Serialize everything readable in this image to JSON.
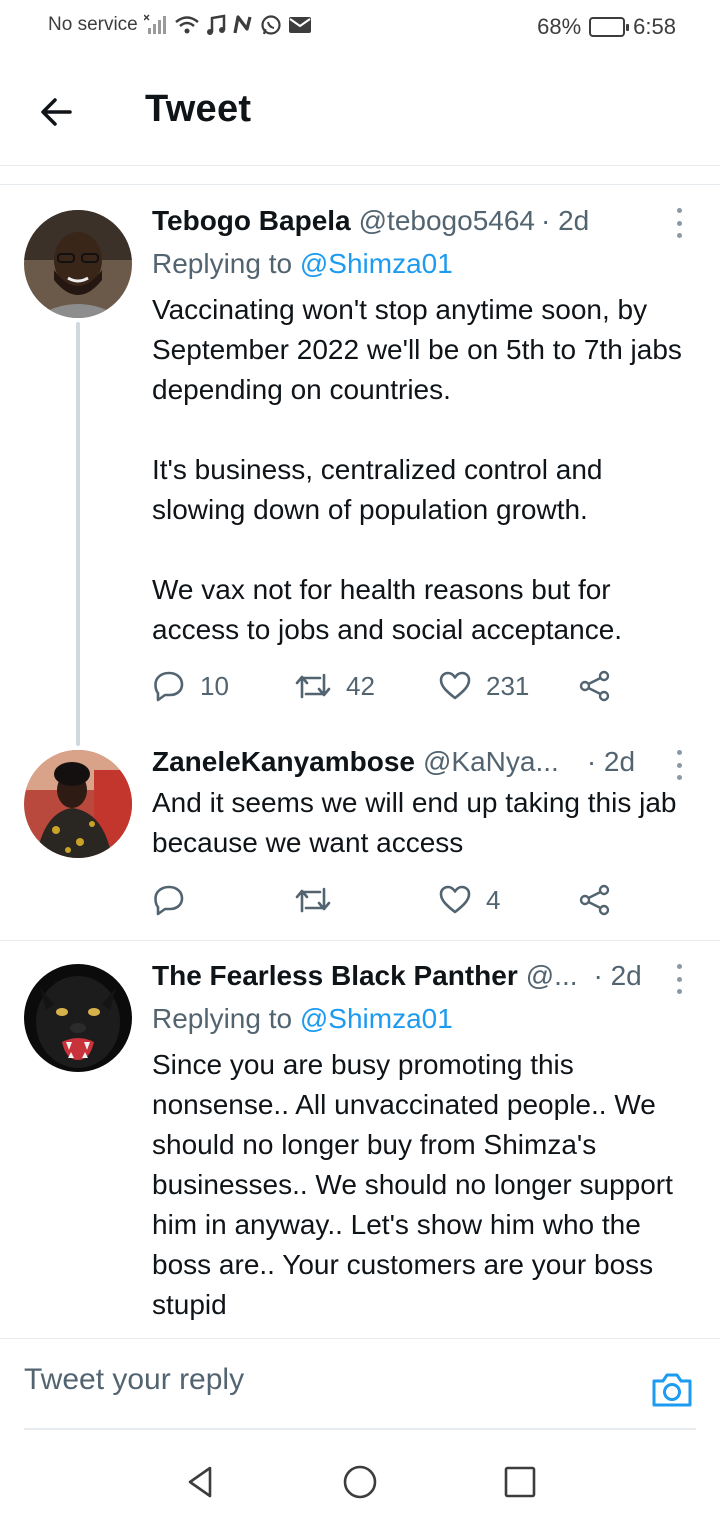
{
  "status_bar": {
    "carrier": "No service",
    "battery_percent": "68%",
    "battery_level": 0.68,
    "time": "6:58",
    "icons": [
      "signal-off-icon",
      "wifi-icon",
      "music-icon",
      "n-app-icon",
      "whatsapp-icon",
      "mail-icon"
    ]
  },
  "header": {
    "title": "Tweet"
  },
  "tweets": [
    {
      "name": "Tebogo Bapela",
      "handle": "@tebogo5464",
      "time": "· 2d",
      "replying_prefix": "Replying to",
      "replying_to": "@Shimza01",
      "text": "Vaccinating won't stop anytime soon, by September 2022 we'll be on 5th to 7th jabs depending on countries.\n\nIt's business, centralized control and slowing down of population growth.\n\nWe vax not for health reasons but for access to jobs and social acceptance.",
      "replies": "10",
      "retweets": "42",
      "likes": "231"
    },
    {
      "name": "ZaneleKanyambose",
      "handle": "@KaNya...",
      "time": "· 2d",
      "text": "And it seems we will end up taking this jab because we want access",
      "replies": "",
      "retweets": "",
      "likes": "4"
    },
    {
      "name": "The Fearless Black Panther",
      "handle": "@...",
      "time": "· 2d",
      "replying_prefix": "Replying to",
      "replying_to": "@Shimza01",
      "text": "Since you are busy promoting this nonsense.. All unvaccinated people.. We should no longer buy from Shimza's businesses.. We should no longer support him in anyway.. Let's show him who the boss are.. Your customers are your boss stupid"
    }
  ],
  "reply_bar": {
    "placeholder": "Tweet your reply"
  },
  "colors": {
    "accent": "#1d9bf0",
    "text": "#0f1419",
    "secondary": "#536471",
    "thread_line": "#cfd9de"
  }
}
